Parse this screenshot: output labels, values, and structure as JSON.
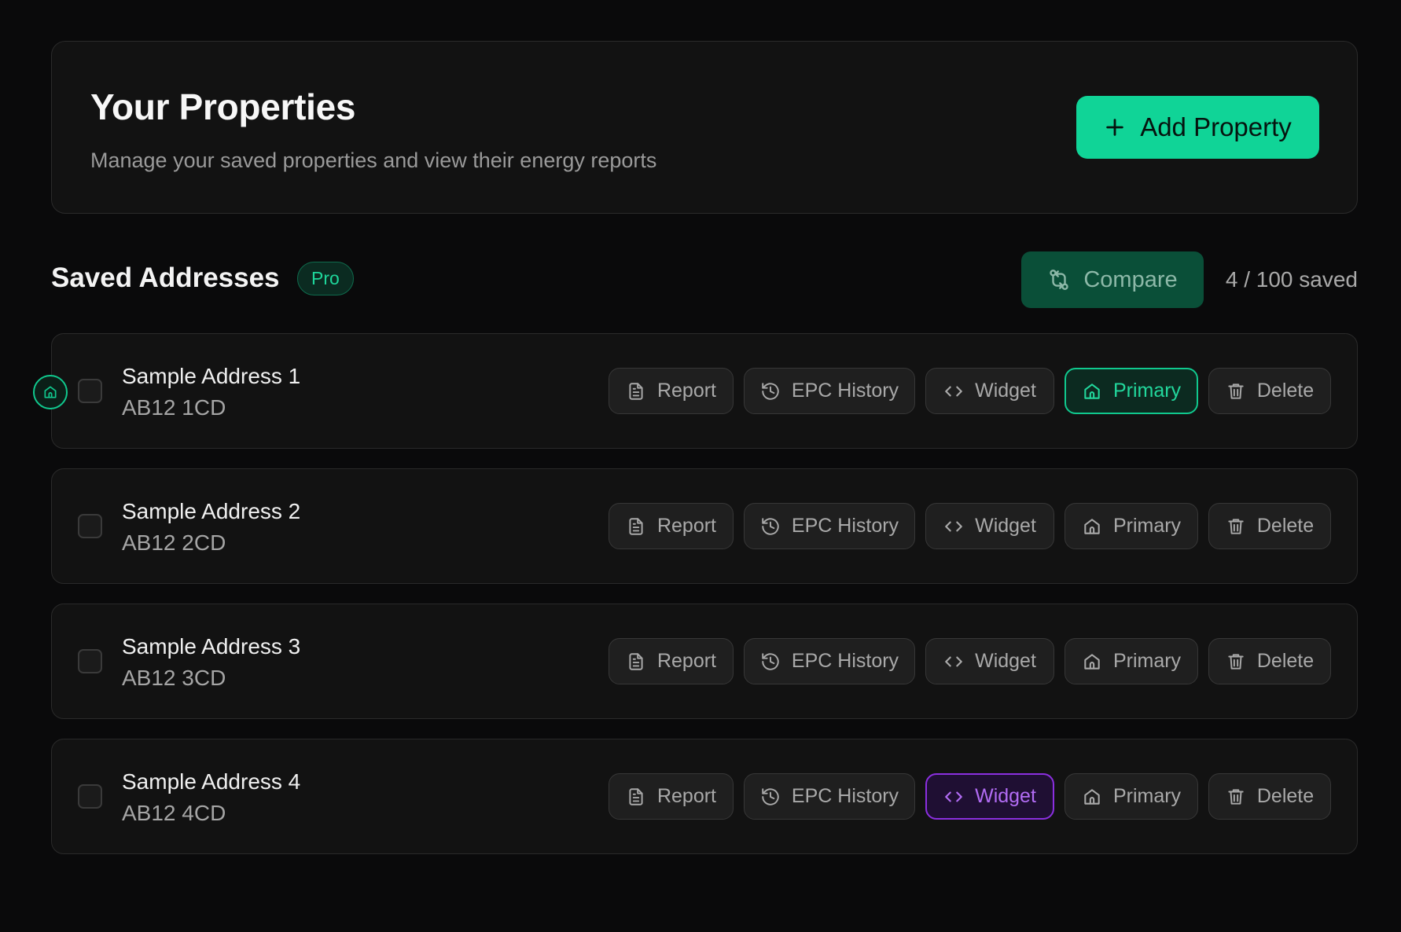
{
  "header": {
    "title": "Your Properties",
    "subtitle": "Manage your saved properties and view their energy reports",
    "add_button_label": "Add Property"
  },
  "section": {
    "title": "Saved Addresses",
    "badge": "Pro",
    "compare_label": "Compare",
    "saved_count": "4 / 100 saved"
  },
  "actions": {
    "report": "Report",
    "epc_history": "EPC History",
    "widget": "Widget",
    "primary": "Primary",
    "delete": "Delete"
  },
  "addresses": [
    {
      "name": "Sample Address 1",
      "postcode": "AB12 1CD",
      "is_primary": true,
      "widget_active": false
    },
    {
      "name": "Sample Address 2",
      "postcode": "AB12 2CD",
      "is_primary": false,
      "widget_active": false
    },
    {
      "name": "Sample Address 3",
      "postcode": "AB12 3CD",
      "is_primary": false,
      "widget_active": false
    },
    {
      "name": "Sample Address 4",
      "postcode": "AB12 4CD",
      "is_primary": false,
      "widget_active": true
    }
  ],
  "icons": {
    "add": "plus-icon",
    "compare": "compare-icon",
    "report": "document-icon",
    "epc_history": "history-icon",
    "widget": "code-icon",
    "primary": "home-icon",
    "delete": "trash-icon"
  },
  "colors": {
    "accent": "#10d497",
    "widget_active": "#8b2fe0",
    "background": "#0a0a0b",
    "card": "#121212"
  }
}
